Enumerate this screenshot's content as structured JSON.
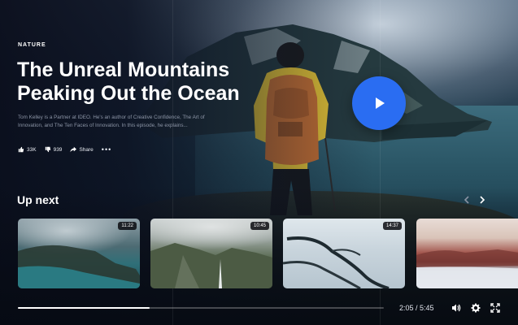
{
  "hero": {
    "category": "NATURE",
    "title": "The Unreal Mountains Peaking Out the Ocean",
    "description": "Tom Kelley is a Partner at IDEO. He's an author of Creative Confidence, The Art of Innovation, and The Ten Faces of Innovation. In this episode, he explains...",
    "likes": "33K",
    "dislikes": "939",
    "share_label": "Share",
    "more_label": "•••"
  },
  "up_next": {
    "title": "Up next",
    "items": [
      {
        "duration": "11:22"
      },
      {
        "duration": "10:45"
      },
      {
        "duration": "14:37"
      },
      {
        "duration": ""
      }
    ]
  },
  "player": {
    "time": "2:05 / 5:45",
    "progress": 0.36
  },
  "colors": {
    "accent": "#2a6df2",
    "background": "#0a1220"
  }
}
